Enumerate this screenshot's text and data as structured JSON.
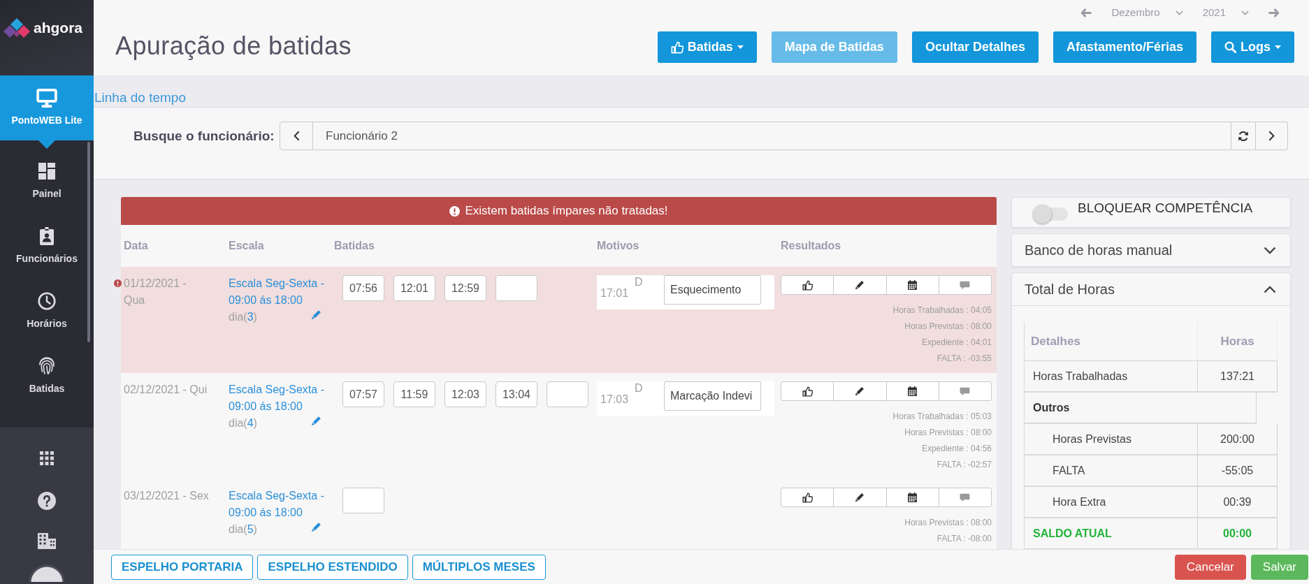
{
  "sidebar": {
    "logo": "ahgora",
    "items": [
      {
        "label": "PontoWEB Lite",
        "selected": true
      },
      {
        "label": "Painel",
        "selected": false
      },
      {
        "label": "Funcionários",
        "selected": false
      },
      {
        "label": "Horários",
        "selected": false
      },
      {
        "label": "Batidas",
        "selected": false
      }
    ]
  },
  "header": {
    "title": "Apuração de batidas",
    "month": "Dezembro",
    "year": "2021",
    "buttons": [
      {
        "label": "Batidas",
        "kind": "menu",
        "disabled": false
      },
      {
        "label": "Mapa de Batidas",
        "kind": "plain",
        "disabled": true
      },
      {
        "label": "Ocultar Detalhes",
        "kind": "plain",
        "disabled": false
      },
      {
        "label": "Afastamento/Férias",
        "kind": "plain",
        "disabled": false
      },
      {
        "label": "Logs",
        "kind": "menu",
        "disabled": false
      }
    ]
  },
  "timeline_link": "Linha do tempo",
  "employee_search": {
    "label": "Busque o funcionário:",
    "value": "Funcionário 2"
  },
  "table": {
    "alert": "Existem batidas ímpares não tratadas!",
    "columns": [
      "Data",
      "Escala",
      "Batidas",
      "Motivos",
      "Resultados"
    ],
    "rows": [
      {
        "flagged": true,
        "date": "01/12/2021 - Qua",
        "schedule": "Escala Seg-Sexta - 09:00 ás 18:00",
        "day": {
          "prefix": "dia(",
          "number": "3",
          "suffix": ")"
        },
        "punches": [
          "07:56",
          "12:01",
          "12:59"
        ],
        "blank_field": true,
        "reason": {
          "time": "17:01",
          "code": "D",
          "text": "Esquecimento"
        },
        "summary": [
          "Horas Trabalhadas : 04:05",
          "Horas Previstas : 08:00",
          "Expediente : 04:01",
          "FALTA : -03:55"
        ]
      },
      {
        "flagged": false,
        "date": "02/12/2021 - Qui",
        "schedule": "Escala Seg-Sexta - 09:00 ás 18:00",
        "day": {
          "prefix": "dia(",
          "number": "4",
          "suffix": ")"
        },
        "punches": [
          "07:57",
          "11:59",
          "12:03",
          "13:04"
        ],
        "blank_field": true,
        "reason": {
          "time": "17:03",
          "code": "D",
          "text": "Marcação Indevi"
        },
        "summary": [
          "Horas Trabalhadas : 05:03",
          "Horas Previstas : 08:00",
          "Expediente : 04:56",
          "FALTA : -02:57"
        ]
      },
      {
        "flagged": false,
        "date": "03/12/2021 - Sex",
        "schedule": "Escala Seg-Sexta - 09:00 ás 18:00",
        "day": {
          "prefix": "dia(",
          "number": "5",
          "suffix": ")"
        },
        "blank_field": true,
        "summary": [
          "Horas Previstas : 08:00",
          "FALTA : -08:00"
        ]
      }
    ]
  },
  "right_panel": {
    "lock": {
      "label": "BLOQUEAR COMPETÊNCIA",
      "on": false
    },
    "sections": [
      {
        "title": "Banco de horas manual",
        "expanded": false
      },
      {
        "title": "Total de Horas",
        "expanded": true,
        "table": {
          "columns": [
            "Detalhes",
            "Horas"
          ],
          "rows": [
            {
              "kind": "item",
              "label": "Horas Trabalhadas",
              "value": "137:21"
            },
            {
              "kind": "group",
              "label": "Outros"
            },
            {
              "kind": "subitem",
              "label": "Horas Previstas",
              "value": "200:00"
            },
            {
              "kind": "subitem",
              "label": "FALTA",
              "value": "-55:05"
            },
            {
              "kind": "subitem",
              "label": "Hora Extra",
              "value": "00:39"
            },
            {
              "kind": "total",
              "label": "SALDO ATUAL",
              "value": "00:00"
            }
          ]
        }
      }
    ]
  },
  "footer": {
    "reports": [
      "ESPELHO PORTARIA",
      "ESPELHO ESTENDIDO",
      "MÚLTIPLOS MESES"
    ],
    "actions": [
      {
        "label": "Cancelar",
        "kind": "danger"
      },
      {
        "label": "Salvar",
        "kind": "success"
      }
    ]
  }
}
